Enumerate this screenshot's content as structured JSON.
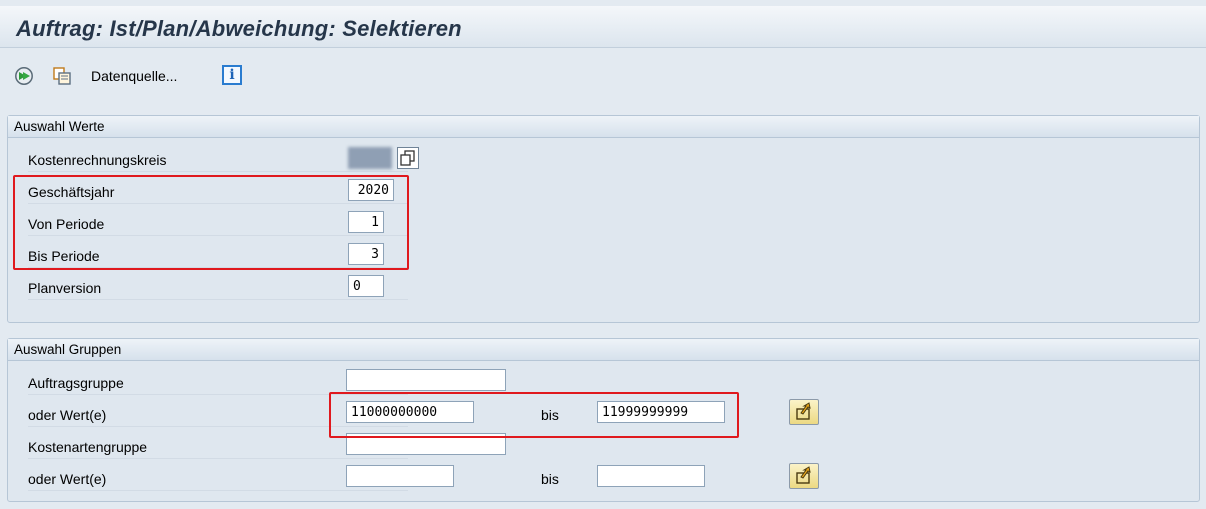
{
  "title": "Auftrag: Ist/Plan/Abweichung: Selektieren",
  "toolbar": {
    "execute_icon": "execute-clock-icon",
    "copy_icon": "copy-variant-icon",
    "datasource_label": "Datenquelle...",
    "info_label": "i"
  },
  "auswahl_werte": {
    "heading": "Auswahl Werte",
    "kostenrechnungskreis_label": "Kostenrechnungskreis",
    "geschaeftsjahr_label": "Geschäftsjahr",
    "geschaeftsjahr_value": "2020",
    "von_periode_label": "Von Periode",
    "von_periode_value": "1",
    "bis_periode_label": "Bis Periode",
    "bis_periode_value": "3",
    "planversion_label": "Planversion",
    "planversion_value": "0"
  },
  "auswahl_gruppen": {
    "heading": "Auswahl Gruppen",
    "auftragsgruppe_label": "Auftragsgruppe",
    "auftragsgruppe_value": "",
    "oder_werte_label": "oder Wert(e)",
    "auftrag_von": "11000000000",
    "bis_label": "bis",
    "auftrag_bis": "11999999999",
    "kostenartengruppe_label": "Kostenartengruppe",
    "kostenartengruppe_value": "",
    "kostenart_von": "",
    "kostenart_bis": ""
  },
  "colors": {
    "highlight": "#e0191e",
    "title_text": "#26364a"
  }
}
